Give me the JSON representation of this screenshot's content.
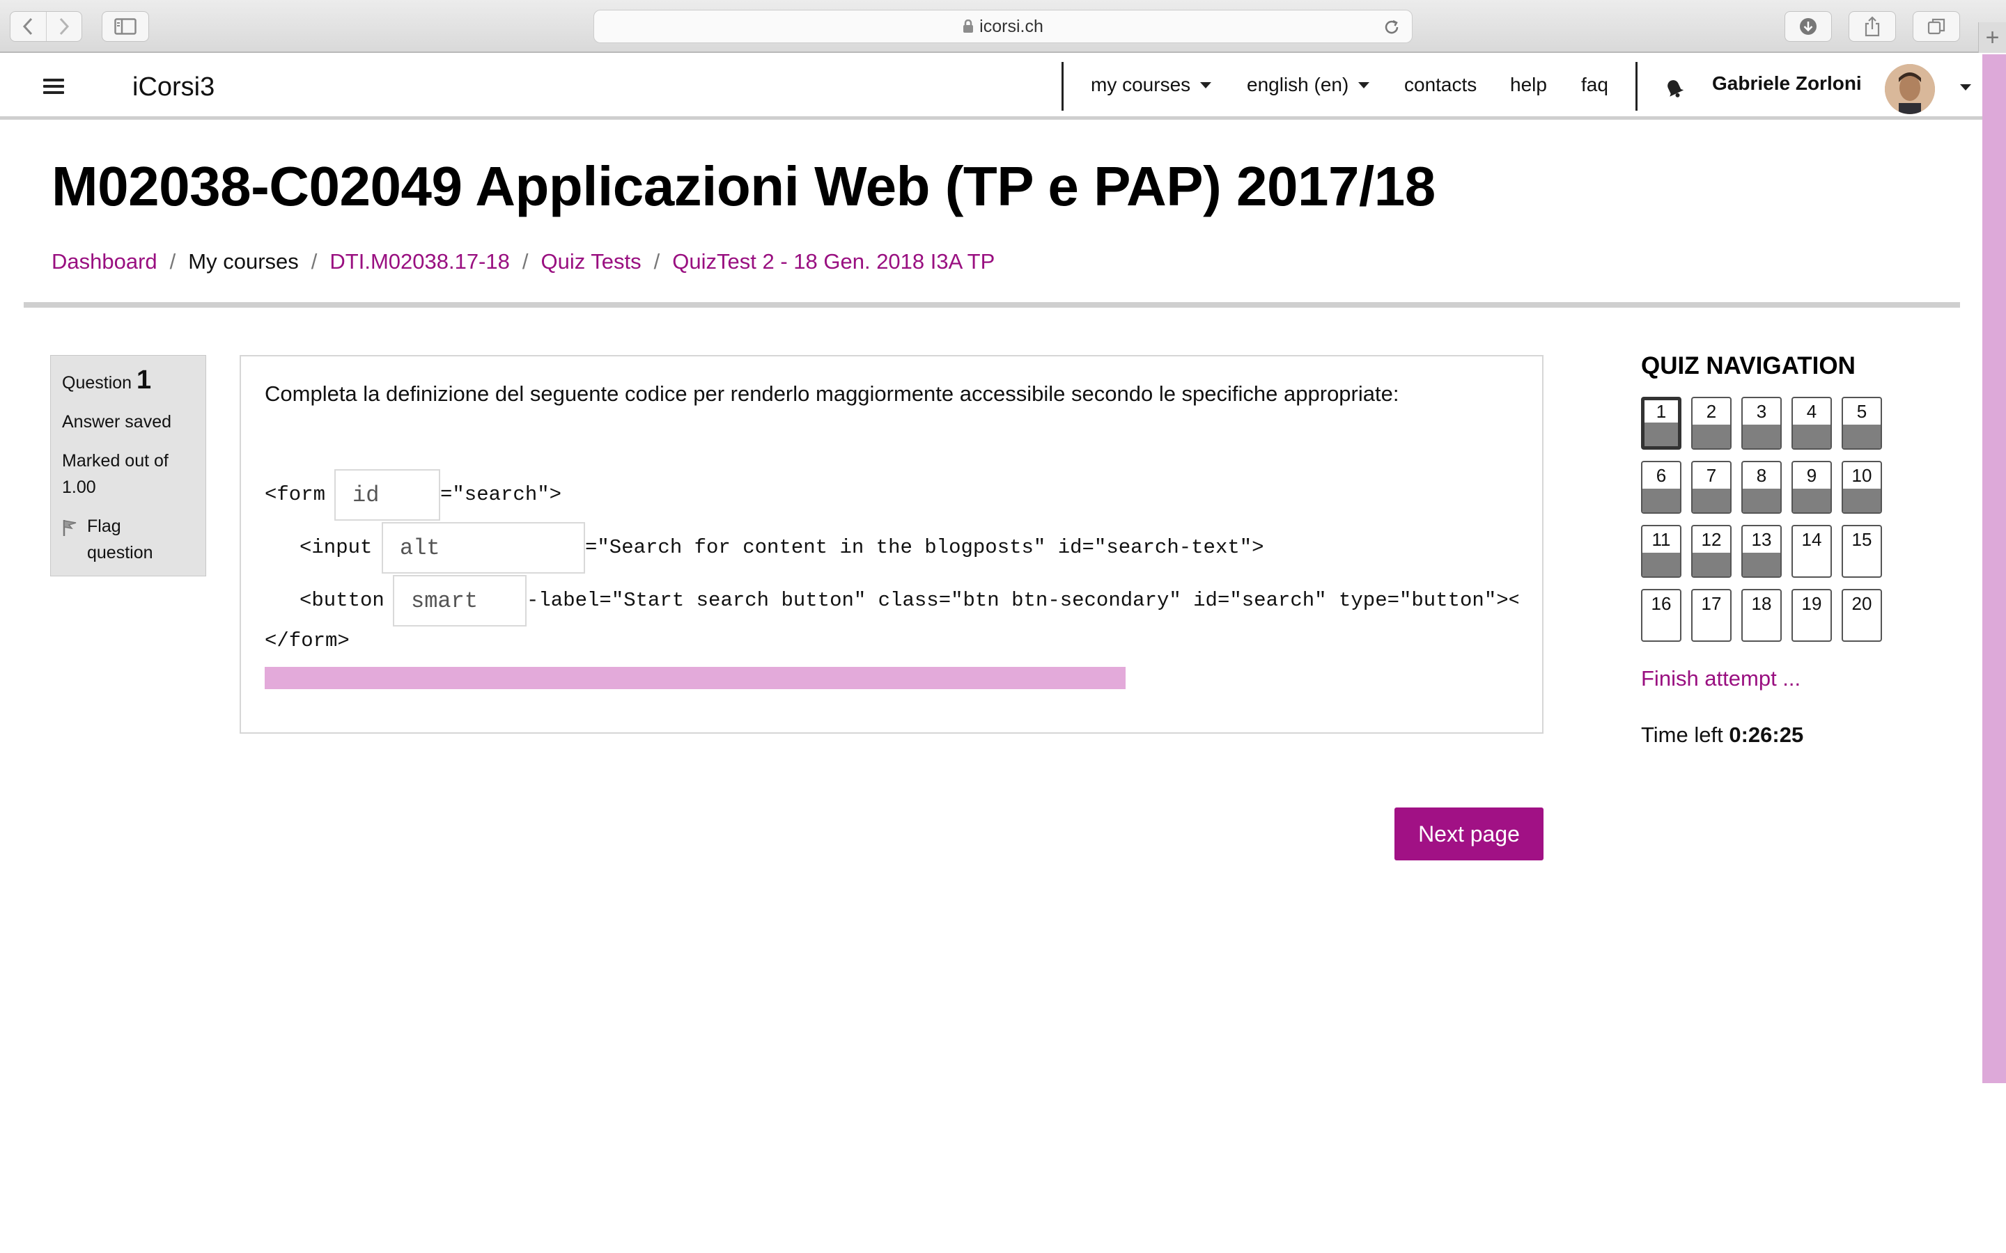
{
  "browser": {
    "url": "icorsi.ch"
  },
  "navbar": {
    "brand": "iCorsi3",
    "items": [
      {
        "label": "my courses",
        "dropdown": true
      },
      {
        "label": "english (en)",
        "dropdown": true
      },
      {
        "label": "contacts",
        "dropdown": false
      },
      {
        "label": "help",
        "dropdown": false
      },
      {
        "label": "faq",
        "dropdown": false
      }
    ],
    "user_name": "Gabriele Zorloni"
  },
  "page": {
    "title": "M02038-C02049 Applicazioni Web (TP e PAP) 2017/18",
    "breadcrumb": [
      {
        "label": "Dashboard",
        "link": true
      },
      {
        "label": "My courses",
        "link": false
      },
      {
        "label": "DTI.M02038.17-18",
        "link": true
      },
      {
        "label": "Quiz Tests",
        "link": true
      },
      {
        "label": "QuizTest 2 - 18 Gen. 2018 I3A TP",
        "link": true
      }
    ]
  },
  "question_info": {
    "label": "Question",
    "number": "1",
    "state": "Answer saved",
    "marked_out_of": "Marked out of",
    "mark_value": "1.00",
    "flag_line1": "Flag",
    "flag_line2": "question"
  },
  "question": {
    "text": "Completa la definizione del seguente codice per renderlo maggiormente accessibile secondo le specifiche appropriate:",
    "line1": {
      "prefix": "<form",
      "gap_value": "id",
      "suffix": "=\"search\">"
    },
    "line2": {
      "prefix": "<input",
      "gap_value": "alt",
      "suffix": "=\"Search for content in the blogposts\" id=\"search-text\">"
    },
    "line3": {
      "prefix": "<button",
      "gap_value": "smart",
      "suffix": "-label=\"Start search button\" class=\"btn btn-secondary\" id=\"search\" type=\"button\"><span"
    },
    "line4": "</form>"
  },
  "actions": {
    "next_label": "Next page"
  },
  "quiz_nav": {
    "title": "QUIZ NAVIGATION",
    "current": 1,
    "answered": [
      1,
      2,
      3,
      4,
      5,
      6,
      7,
      8,
      9,
      10,
      11,
      12,
      13
    ],
    "questions": [
      "1",
      "2",
      "3",
      "4",
      "5",
      "6",
      "7",
      "8",
      "9",
      "10",
      "11",
      "12",
      "13",
      "14",
      "15",
      "16",
      "17",
      "18",
      "19",
      "20"
    ],
    "finish_label": "Finish attempt ...",
    "time_left_label": "Time left",
    "time_left_value": "0:26:25"
  },
  "colors": {
    "accent": "#990f80",
    "button": "#a11185",
    "scrollbar": "#dda9d9"
  }
}
